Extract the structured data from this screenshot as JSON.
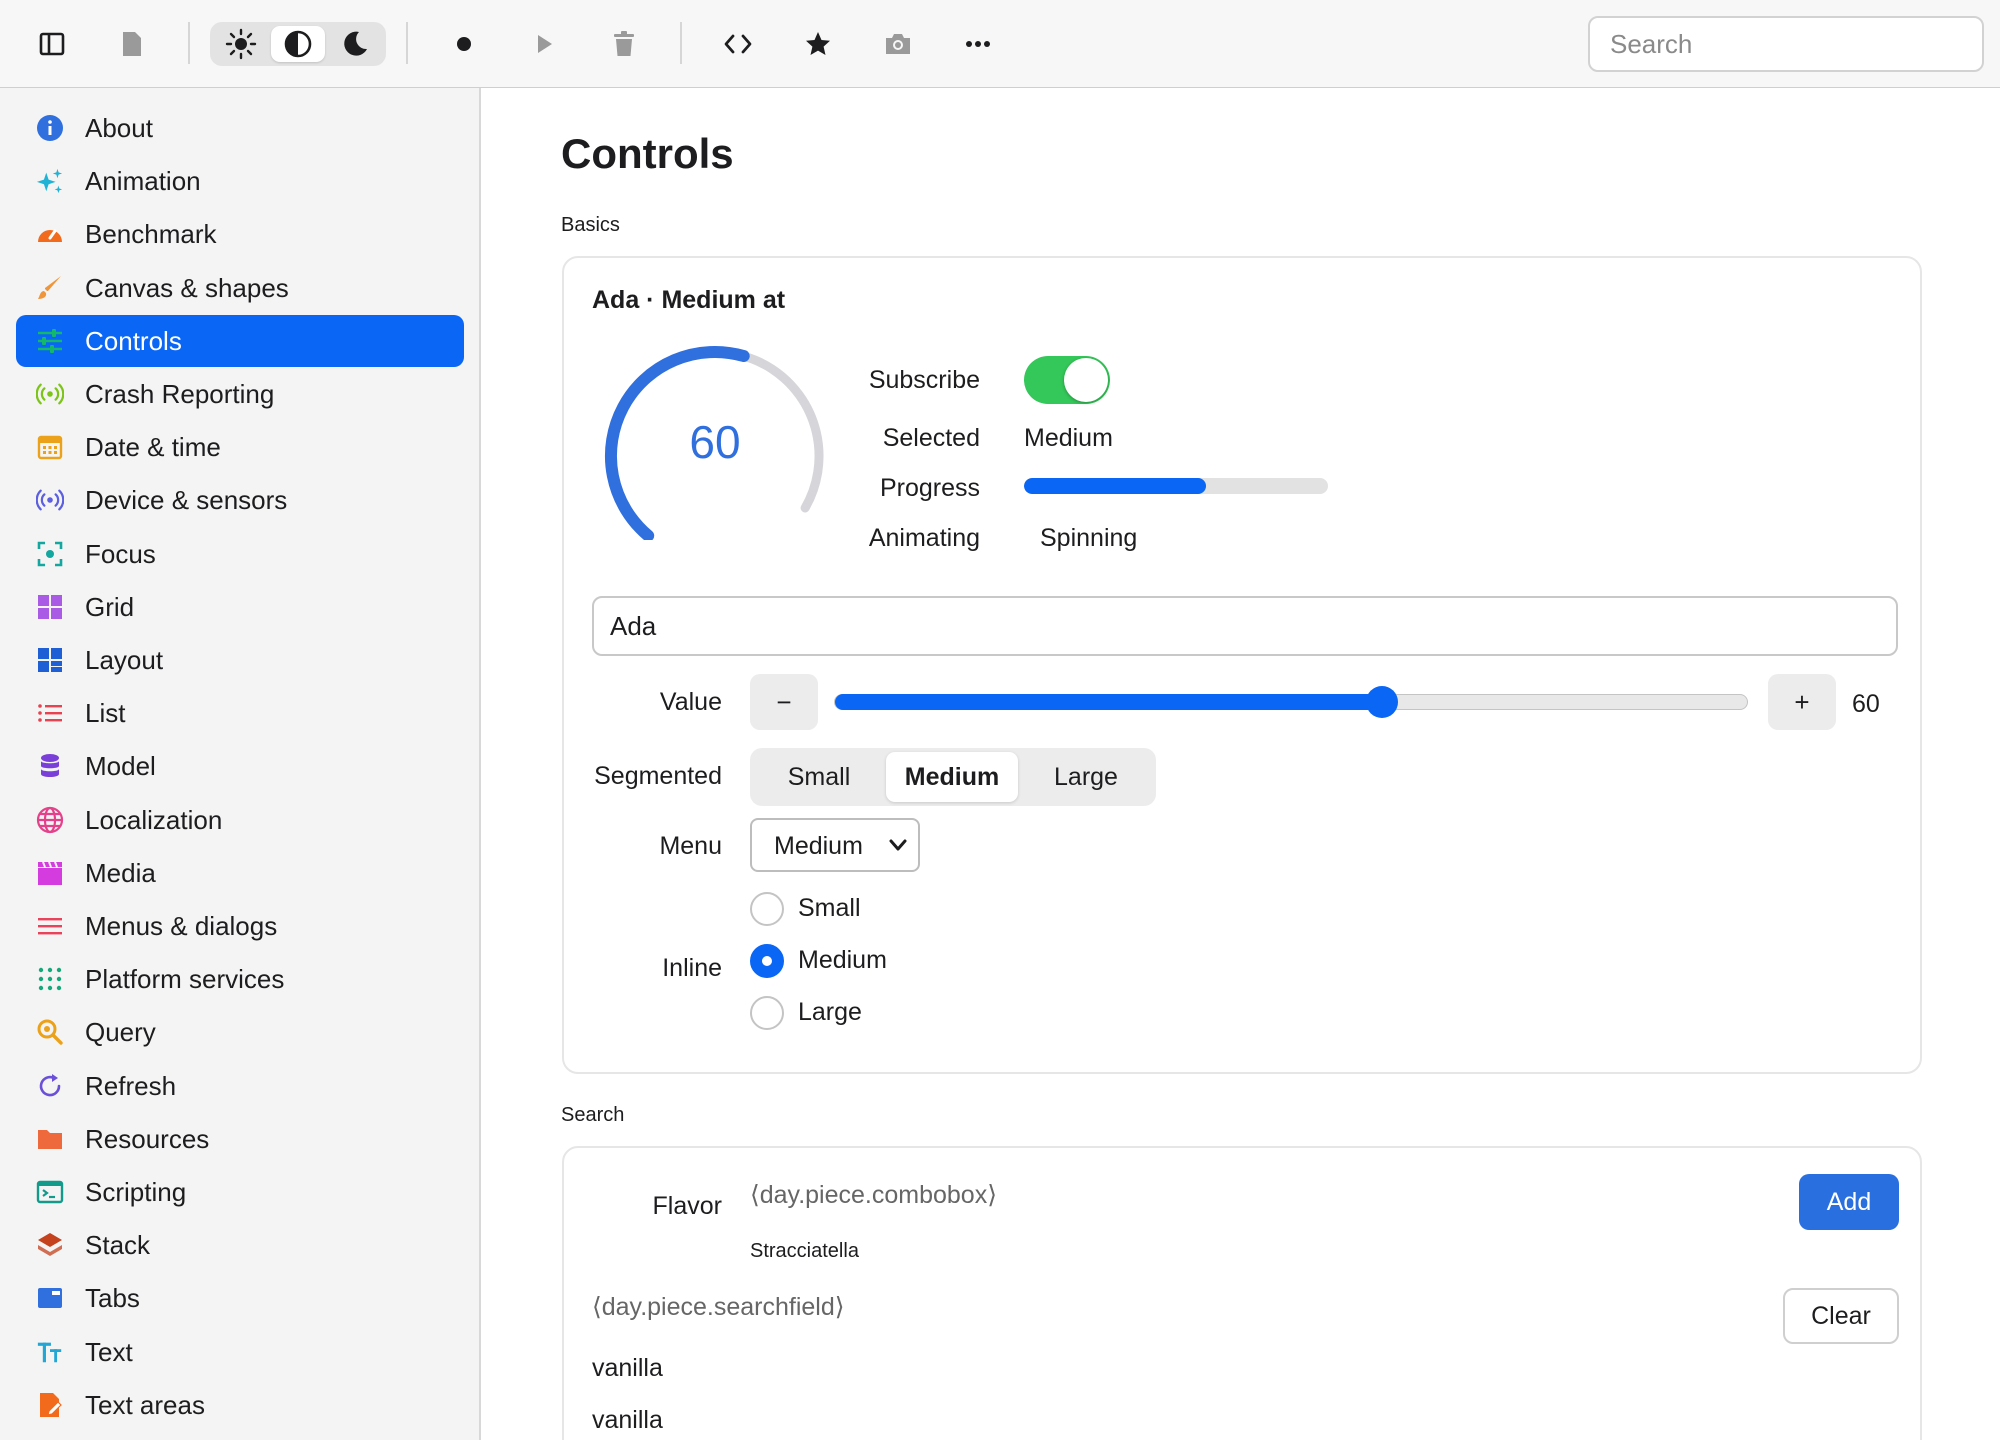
{
  "toolbar": {
    "search_placeholder": "Search",
    "icons": [
      "sidebar-toggle-icon",
      "document-icon",
      "sun-icon",
      "contrast-icon",
      "moon-icon",
      "record-icon",
      "play-icon",
      "trash-icon",
      "code-icon",
      "star-icon",
      "camera-icon",
      "more-icon"
    ],
    "active_theme": "contrast"
  },
  "sidebar": {
    "selected": "Controls",
    "items": [
      {
        "label": "About",
        "icon": "info-icon",
        "color": "#2f6fde"
      },
      {
        "label": "Animation",
        "icon": "sparkles-icon",
        "color": "#21b3d6"
      },
      {
        "label": "Benchmark",
        "icon": "gauge-icon",
        "color": "#f26b1d"
      },
      {
        "label": "Canvas & shapes",
        "icon": "brush-icon",
        "color": "#f0963a"
      },
      {
        "label": "Controls",
        "icon": "sliders-icon",
        "color": "#14b86a"
      },
      {
        "label": "Crash Reporting",
        "icon": "broadcast-icon",
        "color": "#7cc417"
      },
      {
        "label": "Date & time",
        "icon": "calendar-icon",
        "color": "#eba21a"
      },
      {
        "label": "Device & sensors",
        "icon": "sensor-icon",
        "color": "#5b5fe0"
      },
      {
        "label": "Focus",
        "icon": "focus-icon",
        "color": "#13a7a0"
      },
      {
        "label": "Grid",
        "icon": "grid-icon",
        "color": "#a95be6"
      },
      {
        "label": "Layout",
        "icon": "layout-icon",
        "color": "#1f5fd6"
      },
      {
        "label": "List",
        "icon": "list-icon",
        "color": "#e84150"
      },
      {
        "label": "Model",
        "icon": "database-icon",
        "color": "#7b3fd9"
      },
      {
        "label": "Localization",
        "icon": "globe-icon",
        "color": "#e4418a"
      },
      {
        "label": "Media",
        "icon": "film-icon",
        "color": "#d43ce0"
      },
      {
        "label": "Menus & dialogs",
        "icon": "menu-lines-icon",
        "color": "#e8435a"
      },
      {
        "label": "Platform services",
        "icon": "dots-grid-icon",
        "color": "#15a87a"
      },
      {
        "label": "Query",
        "icon": "search-query-icon",
        "color": "#eba21a"
      },
      {
        "label": "Refresh",
        "icon": "refresh-icon",
        "color": "#6a4fd8"
      },
      {
        "label": "Resources",
        "icon": "folder-icon",
        "color": "#ee6a3c"
      },
      {
        "label": "Scripting",
        "icon": "terminal-icon",
        "color": "#129a8a"
      },
      {
        "label": "Stack",
        "icon": "stack-icon",
        "color": "#c4421d"
      },
      {
        "label": "Tabs",
        "icon": "tabs-icon",
        "color": "#2f6fde"
      },
      {
        "label": "Text",
        "icon": "text-icon",
        "color": "#21a7d6"
      },
      {
        "label": "Text areas",
        "icon": "text-area-icon",
        "color": "#f26b1d"
      }
    ]
  },
  "main": {
    "title": "Controls",
    "basics": {
      "section_label": "Basics",
      "card_title": "Ada · Medium at",
      "gauge": {
        "value": 60,
        "min": 0,
        "max": 100,
        "label": "60"
      },
      "info": {
        "subscribe_label": "Subscribe",
        "subscribe_on": true,
        "selected_label": "Selected",
        "selected_value": "Medium",
        "progress_label": "Progress",
        "progress_value": 0.6,
        "animating_label": "Animating",
        "animating_value": "Spinning"
      },
      "name_value": "Ada",
      "value_row": {
        "label": "Value",
        "minus": "−",
        "plus": "+",
        "value": 60,
        "value_label": "60",
        "min": 0,
        "max": 100
      },
      "segmented": {
        "label": "Segmented",
        "options": [
          "Small",
          "Medium",
          "Large"
        ],
        "selected": "Medium"
      },
      "menu": {
        "label": "Menu",
        "value": "Medium"
      },
      "inline": {
        "label": "Inline",
        "options": [
          "Small",
          "Medium",
          "Large"
        ],
        "selected": "Medium"
      }
    },
    "search": {
      "section_label": "Search",
      "flavor_label": "Flavor",
      "combobox_token": "⟨day.piece.combobox⟩",
      "add_label": "Add",
      "flavor_value": "Stracciatella",
      "searchfield_token": "⟨day.piece.searchfield⟩",
      "clear_label": "Clear",
      "results": [
        "vanilla",
        "vanilla"
      ]
    }
  },
  "colors": {
    "accent": "#0a66f5",
    "toggle_on": "#34c759",
    "gauge_track": "#d6d6da",
    "gauge_fill": "#2f6fde"
  }
}
